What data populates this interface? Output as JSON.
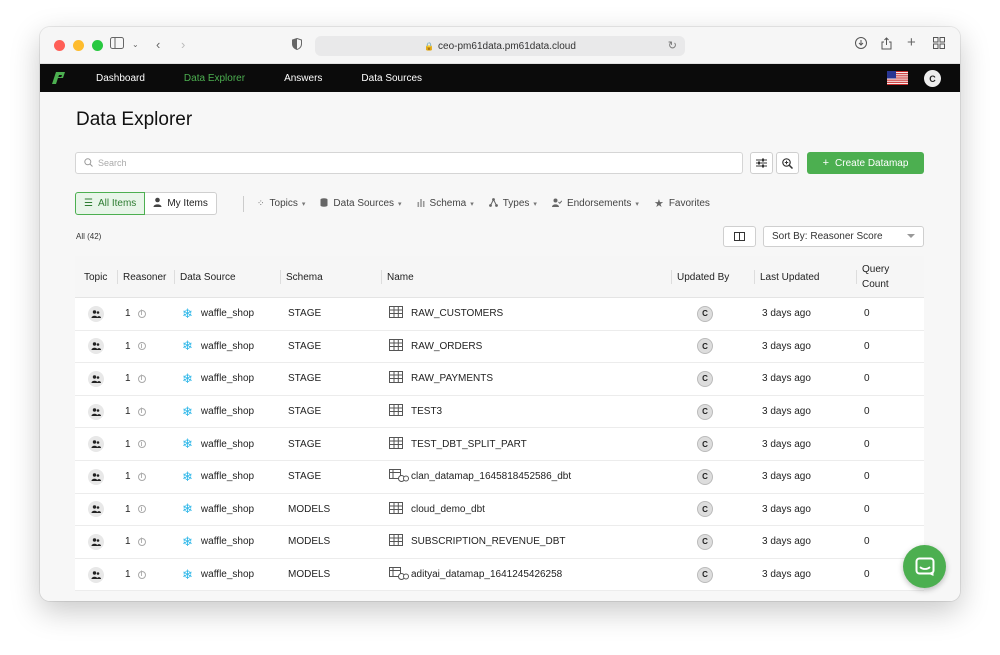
{
  "browser": {
    "url": "ceo-pm61data.pm61data.cloud"
  },
  "nav": {
    "items": [
      {
        "label": "Dashboard",
        "active": false
      },
      {
        "label": "Data Explorer",
        "active": true
      },
      {
        "label": "Answers",
        "active": false
      },
      {
        "label": "Data Sources",
        "active": false
      }
    ],
    "user_initial": "C",
    "accent": "#4caf50"
  },
  "page": {
    "title": "Data Explorer",
    "search_placeholder": "Search",
    "create_label": "Create Datamap",
    "all_items_label": "All Items",
    "my_items_label": "My Items",
    "filters": [
      {
        "label": "Topics",
        "icon": "grid-icon",
        "chevron": true
      },
      {
        "label": "Data Sources",
        "icon": "database-icon",
        "chevron": true
      },
      {
        "label": "Schema",
        "icon": "schema-icon",
        "chevron": true
      },
      {
        "label": "Types",
        "icon": "types-icon",
        "chevron": true
      },
      {
        "label": "Endorsements",
        "icon": "endorse-icon",
        "chevron": true
      },
      {
        "label": "Favorites",
        "icon": "star-icon",
        "chevron": false
      }
    ],
    "count_label": "All (42)",
    "sort_label": "Sort By: Reasoner Score"
  },
  "table": {
    "headers": {
      "topic": "Topic",
      "reasoner": "Reasoner",
      "source": "Data Source",
      "schema": "Schema",
      "name": "Name",
      "updated_by": "Updated By",
      "last_updated": "Last Updated",
      "query_count_1": "Query",
      "query_count_2": "Count"
    },
    "rows": [
      {
        "reasoner": "1",
        "source": "waffle_shop",
        "schema": "STAGE",
        "name": "RAW_CUSTOMERS",
        "type": "table",
        "updated_by": "C",
        "last_updated": "3 days ago",
        "query_count": "0"
      },
      {
        "reasoner": "1",
        "source": "waffle_shop",
        "schema": "STAGE",
        "name": "RAW_ORDERS",
        "type": "table",
        "updated_by": "C",
        "last_updated": "3 days ago",
        "query_count": "0"
      },
      {
        "reasoner": "1",
        "source": "waffle_shop",
        "schema": "STAGE",
        "name": "RAW_PAYMENTS",
        "type": "table",
        "updated_by": "C",
        "last_updated": "3 days ago",
        "query_count": "0"
      },
      {
        "reasoner": "1",
        "source": "waffle_shop",
        "schema": "STAGE",
        "name": "TEST3",
        "type": "table",
        "updated_by": "C",
        "last_updated": "3 days ago",
        "query_count": "0"
      },
      {
        "reasoner": "1",
        "source": "waffle_shop",
        "schema": "STAGE",
        "name": "TEST_DBT_SPLIT_PART",
        "type": "table",
        "updated_by": "C",
        "last_updated": "3 days ago",
        "query_count": "0"
      },
      {
        "reasoner": "1",
        "source": "waffle_shop",
        "schema": "STAGE",
        "name": "clan_datamap_1645818452586_dbt",
        "type": "datamap",
        "updated_by": "C",
        "last_updated": "3 days ago",
        "query_count": "0"
      },
      {
        "reasoner": "1",
        "source": "waffle_shop",
        "schema": "MODELS",
        "name": "cloud_demo_dbt",
        "type": "table",
        "updated_by": "C",
        "last_updated": "3 days ago",
        "query_count": "0"
      },
      {
        "reasoner": "1",
        "source": "waffle_shop",
        "schema": "MODELS",
        "name": "SUBSCRIPTION_REVENUE_DBT",
        "type": "table",
        "updated_by": "C",
        "last_updated": "3 days ago",
        "query_count": "0"
      },
      {
        "reasoner": "1",
        "source": "waffle_shop",
        "schema": "MODELS",
        "name": "adityai_datamap_1641245426258",
        "type": "datamap",
        "updated_by": "C",
        "last_updated": "3 days ago",
        "query_count": "0"
      }
    ]
  }
}
